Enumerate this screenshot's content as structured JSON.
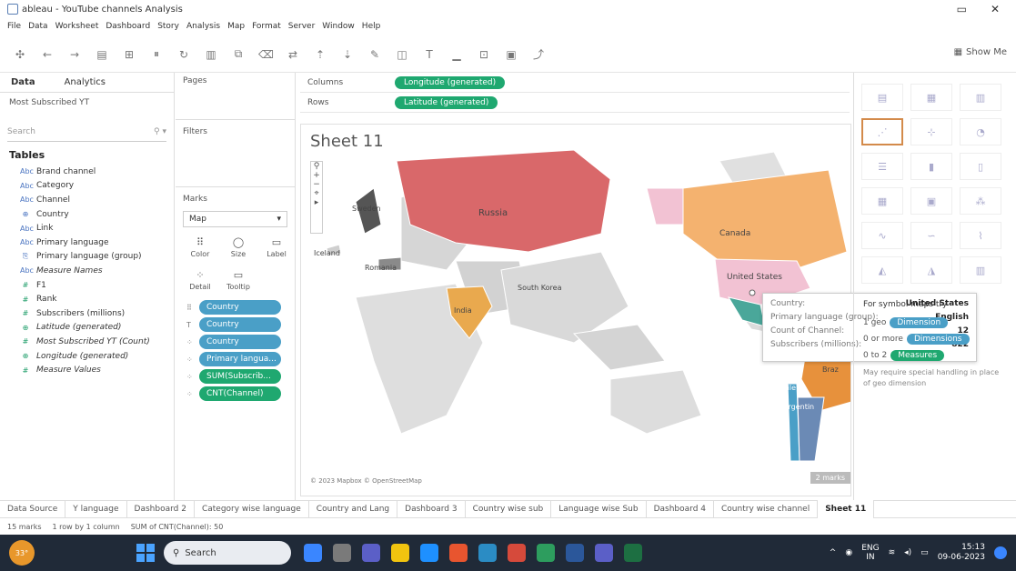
{
  "titlebar": {
    "title": "ableau - YouTube channels Analysis",
    "min": "▭",
    "close": "✕"
  },
  "menu": [
    "File",
    "Data",
    "Worksheet",
    "Dashboard",
    "Story",
    "Analysis",
    "Map",
    "Format",
    "Server",
    "Window",
    "Help"
  ],
  "toolbar": {
    "show_me": "Show Me"
  },
  "data_pane": {
    "tabs": [
      "Data",
      "Analytics"
    ],
    "source": "Most Subscribed YT",
    "search_placeholder": "Search",
    "tables_label": "Tables",
    "fields": [
      {
        "type": "dim",
        "glyph": "Abc",
        "name": "Brand channel"
      },
      {
        "type": "dim",
        "glyph": "Abc",
        "name": "Category"
      },
      {
        "type": "dim",
        "glyph": "Abc",
        "name": "Channel"
      },
      {
        "type": "dim",
        "glyph": "⊕",
        "name": "Country"
      },
      {
        "type": "dim",
        "glyph": "Abc",
        "name": "Link"
      },
      {
        "type": "dim",
        "glyph": "Abc",
        "name": "Primary language"
      },
      {
        "type": "dim",
        "glyph": "⎘",
        "name": "Primary language (group)"
      },
      {
        "type": "dim",
        "glyph": "Abc",
        "name": "Measure Names",
        "italic": true
      },
      {
        "type": "mea",
        "glyph": "#",
        "name": "F1"
      },
      {
        "type": "mea",
        "glyph": "#",
        "name": "Rank"
      },
      {
        "type": "mea",
        "glyph": "#",
        "name": "Subscribers (millions)"
      },
      {
        "type": "mea",
        "glyph": "⊕",
        "name": "Latitude (generated)",
        "italic": true
      },
      {
        "type": "mea",
        "glyph": "#",
        "name": "Most Subscribed YT (Count)",
        "italic": true
      },
      {
        "type": "mea",
        "glyph": "⊕",
        "name": "Longitude (generated)",
        "italic": true
      },
      {
        "type": "mea",
        "glyph": "#",
        "name": "Measure Values",
        "italic": true
      }
    ]
  },
  "cards": {
    "pages": "Pages",
    "filters": "Filters",
    "marks": "Marks",
    "mark_type": "Map",
    "mark_buttons": [
      {
        "glyph": "⠿",
        "label": "Color"
      },
      {
        "glyph": "◯",
        "label": "Size"
      },
      {
        "glyph": "▭",
        "label": "Label"
      },
      {
        "glyph": "⁘",
        "label": "Detail"
      },
      {
        "glyph": "▭",
        "label": "Tooltip"
      }
    ],
    "pills": [
      {
        "icon": "⠿",
        "label": "Country",
        "color": "blue"
      },
      {
        "icon": "T",
        "label": "Country",
        "color": "blue"
      },
      {
        "icon": "⁘",
        "label": "Country",
        "color": "blue"
      },
      {
        "icon": "⁘",
        "label": "Primary langua...",
        "color": "blue"
      },
      {
        "icon": "⁘",
        "label": "SUM(Subscrib...",
        "color": "green"
      },
      {
        "icon": "⁘",
        "label": "CNT(Channel)",
        "color": "green"
      }
    ]
  },
  "shelves": {
    "columns_label": "Columns",
    "columns_pill": "Longitude (generated)",
    "rows_label": "Rows",
    "rows_pill": "Latitude (generated)"
  },
  "viz": {
    "title": "Sheet 11",
    "countries": [
      {
        "name": "Russia",
        "color": "#d9686a"
      },
      {
        "name": "Canada",
        "color": "#f4b26f"
      },
      {
        "name": "United States",
        "color": "#f2c2d3"
      },
      {
        "name": "India",
        "color": "#e9a94e"
      },
      {
        "name": "South Korea",
        "color": "#c9c9c9"
      },
      {
        "name": "Sweden",
        "color": "#555555"
      },
      {
        "name": "Romania",
        "color": "#8a8a8a"
      },
      {
        "name": "Iceland",
        "color": "#cfcfcf"
      },
      {
        "name": "Brazil",
        "color": "#e7913c"
      },
      {
        "name": "Chile",
        "color": "#4a9fc7"
      },
      {
        "name": "Argentina",
        "color": "#6b8ab5"
      },
      {
        "name": "Mexico",
        "color": "#4aa79a"
      }
    ],
    "map_labels": {
      "russia": "Russia",
      "canada": "Canada",
      "us": "United States",
      "india": "India",
      "skorea": "South Korea",
      "sweden": "Sweden",
      "iceland": "Iceland",
      "romania": "Romania",
      "brazil": "Braz",
      "chile": "Chile",
      "argentina": "Argentin"
    },
    "attribution": "© 2023 Mapbox © OpenStreetMap",
    "zoom_badge": "2 marks"
  },
  "tooltip": {
    "rows": [
      {
        "k": "Country:",
        "v": "United States"
      },
      {
        "k": "Primary language (group):",
        "v": "English"
      },
      {
        "k": "Count of Channel:",
        "v": "12"
      },
      {
        "k": "Subscribers (millions):",
        "v": "822"
      }
    ]
  },
  "showme": {
    "heading": "For symbol maps try",
    "rows": [
      {
        "prefix": "1 geo",
        "pill": "Dimension",
        "color": "#4a9fc7"
      },
      {
        "prefix": "0 or more",
        "pill": "Dimensions",
        "color": "#4a9fc7"
      },
      {
        "prefix": "0 to 2",
        "pill": "Measures",
        "color": "#1fa870"
      }
    ],
    "note": "May require special handling in place of geo dimension"
  },
  "sheet_tabs": [
    "Data Source",
    "Y language",
    "Dashboard 2",
    "Category wise language",
    "Country and Lang",
    "Dashboard 3",
    "Country wise sub",
    "Language wise Sub",
    "Dashboard 4",
    "Country wise channel",
    "Sheet 11"
  ],
  "active_tab": "Sheet 11",
  "status": {
    "marks": "15 marks",
    "rows": "1 row by 1 column",
    "sum": "SUM of CNT(Channel): 50"
  },
  "taskbar": {
    "temp": "33°",
    "search": "Search",
    "lang": "ENG",
    "region": "IN",
    "time": "15:13",
    "date": "09-06-2023"
  }
}
